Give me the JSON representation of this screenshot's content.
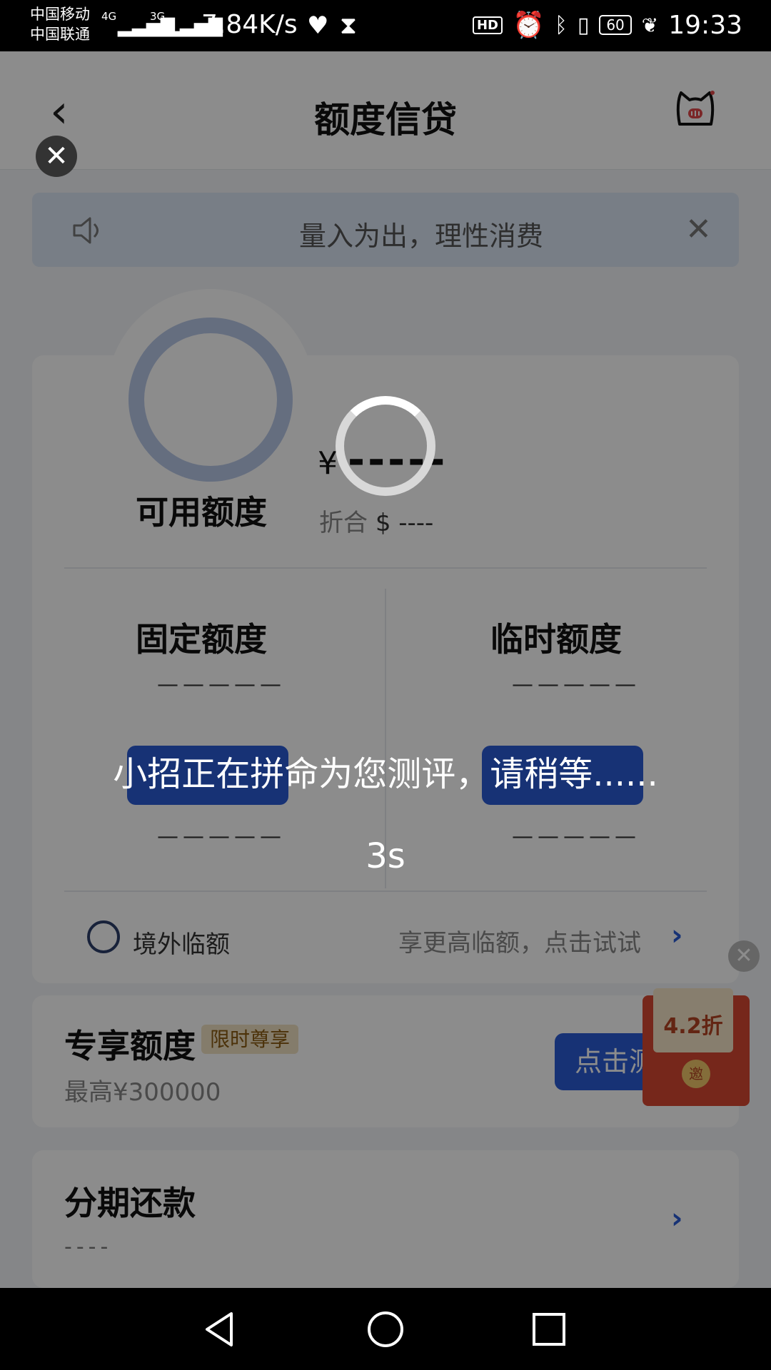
{
  "status_bar": {
    "carrier1": "中国移动",
    "carrier2": "中国联通",
    "net1": "4G",
    "net2": "3G",
    "speed": "7.84K/s",
    "hd": "HD",
    "battery": "60",
    "time": "19:33"
  },
  "header": {
    "title": "额度信贷"
  },
  "notice": {
    "text": "量入为出，理性消费"
  },
  "credit": {
    "available_label": "可用额度",
    "currency": "¥",
    "amount": "-----",
    "conv_prefix": "折合",
    "conv_value": "$ ----",
    "fixed_label": "固定额度",
    "fixed_value": "—————",
    "fixed_sub": "—————",
    "temp_label": "临时额度",
    "temp_value": "—————",
    "temp_sub": "—————",
    "overseas_label": "境外临额",
    "overseas_hint": "享更高临额，点击试试"
  },
  "exclusive": {
    "title": "专享额度",
    "tag": "限时尊享",
    "max": "最高¥300000",
    "button": "点击测"
  },
  "ad": {
    "discount": "4.2折",
    "coin": "邀"
  },
  "installment": {
    "title": "分期还款",
    "value": "----"
  },
  "overlay": {
    "message": "小招正在拼命为您测评，请稍等......",
    "countdown": "3s"
  },
  "colors": {
    "accent": "#2a5bd6",
    "ring": "#b9c8e8",
    "notice_bg": "#dbe6f5"
  }
}
